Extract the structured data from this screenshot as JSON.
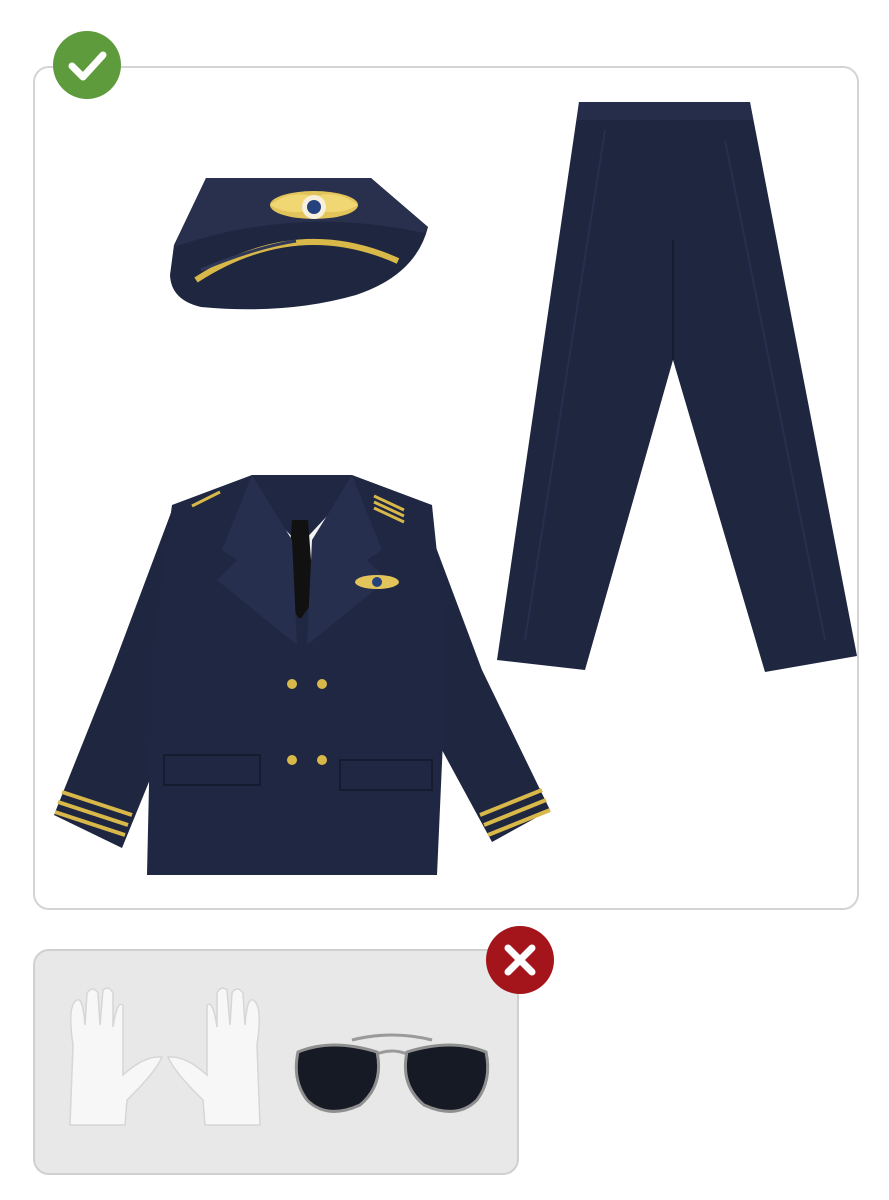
{
  "included": {
    "badge_icon": "check-icon",
    "badge_color": "#5e9b3c",
    "items": [
      "pilot-hat",
      "pilot-jacket",
      "pilot-trousers"
    ],
    "fabric_color": "#1e2640",
    "trim_color": "#d9b84a"
  },
  "excluded": {
    "badge_icon": "cross-icon",
    "badge_color": "#a3151a",
    "items": [
      "white-gloves",
      "aviator-sunglasses"
    ]
  }
}
